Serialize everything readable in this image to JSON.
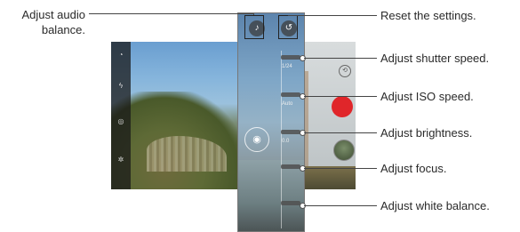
{
  "callouts": {
    "adjust_audio_balance_line1": "Adjust audio",
    "adjust_audio_balance_line2": "balance.",
    "reset_settings": "Reset the settings.",
    "shutter_speed": "Adjust shutter speed.",
    "iso_speed": "Adjust ISO speed.",
    "brightness": "Adjust brightness.",
    "focus": "Adjust focus.",
    "white_balance": "Adjust white balance."
  },
  "panel": {
    "shutter_value": "1/24",
    "iso_value": "Auto",
    "brightness_value": "0.0"
  },
  "colors": {
    "shutter_button": "#e0262a",
    "leader_line": "#444444"
  },
  "icons": [
    "mic-icon",
    "reset-icon",
    "flip-camera-icon",
    "timer-icon",
    "flash-icon",
    "settings-icon",
    "audio-balance-icon"
  ]
}
